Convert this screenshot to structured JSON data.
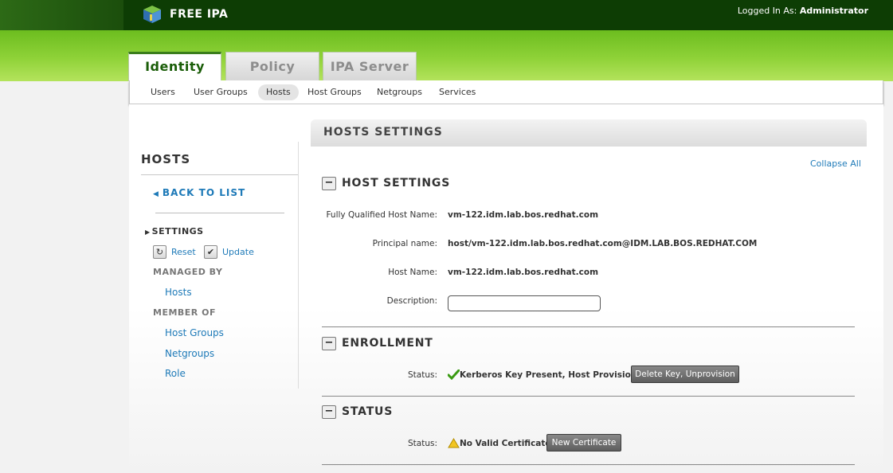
{
  "header": {
    "brand": "FREE IPA",
    "logged_in_label": "Logged In As:",
    "user": "Administrator"
  },
  "tabs": [
    {
      "label": "Identity",
      "active": true
    },
    {
      "label": "Policy",
      "active": false
    },
    {
      "label": "IPA Server",
      "active": false
    }
  ],
  "subnav": [
    {
      "label": "Users",
      "active": false
    },
    {
      "label": "User Groups",
      "active": false
    },
    {
      "label": "Hosts",
      "active": true
    },
    {
      "label": "Host Groups",
      "active": false
    },
    {
      "label": "Netgroups",
      "active": false
    },
    {
      "label": "Services",
      "active": false
    }
  ],
  "sidebar": {
    "title": "HOSTS",
    "back_link": "BACK TO LIST",
    "settings_label": "SETTINGS",
    "reset_label": "Reset",
    "update_label": "Update",
    "managed_by_label": "MANAGED BY",
    "managed_by_items": [
      "Hosts"
    ],
    "member_of_label": "MEMBER OF",
    "member_of_items": [
      "Host Groups",
      "Netgroups",
      "Role"
    ]
  },
  "main": {
    "title": "HOSTS SETTINGS",
    "collapse_all": "Collapse All",
    "host_settings": {
      "title": "HOST SETTINGS",
      "fqdn_label": "Fully Qualified Host Name:",
      "fqdn_value": "vm-122.idm.lab.bos.redhat.com",
      "principal_label": "Principal name:",
      "principal_value": "host/vm-122.idm.lab.bos.redhat.com@IDM.LAB.BOS.REDHAT.COM",
      "hostname_label": "Host Name:",
      "hostname_value": "vm-122.idm.lab.bos.redhat.com",
      "description_label": "Description:",
      "description_value": ""
    },
    "enrollment": {
      "title": "ENROLLMENT",
      "status_label": "Status:",
      "status_value": "Kerberos Key Present, Host Provisioned:",
      "status_icon": "checkmark-icon",
      "button_label": "Delete Key, Unprovision"
    },
    "status": {
      "title": "STATUS",
      "status_label": "Status:",
      "status_value": "No Valid Certificate:",
      "status_icon": "warning-icon",
      "button_label": "New Certificate"
    }
  },
  "colors": {
    "header_dark": "#0d3d04",
    "header_green": "#8fd238",
    "link_blue": "#1e7ab8",
    "active_tab_text": "#1a5d08"
  }
}
